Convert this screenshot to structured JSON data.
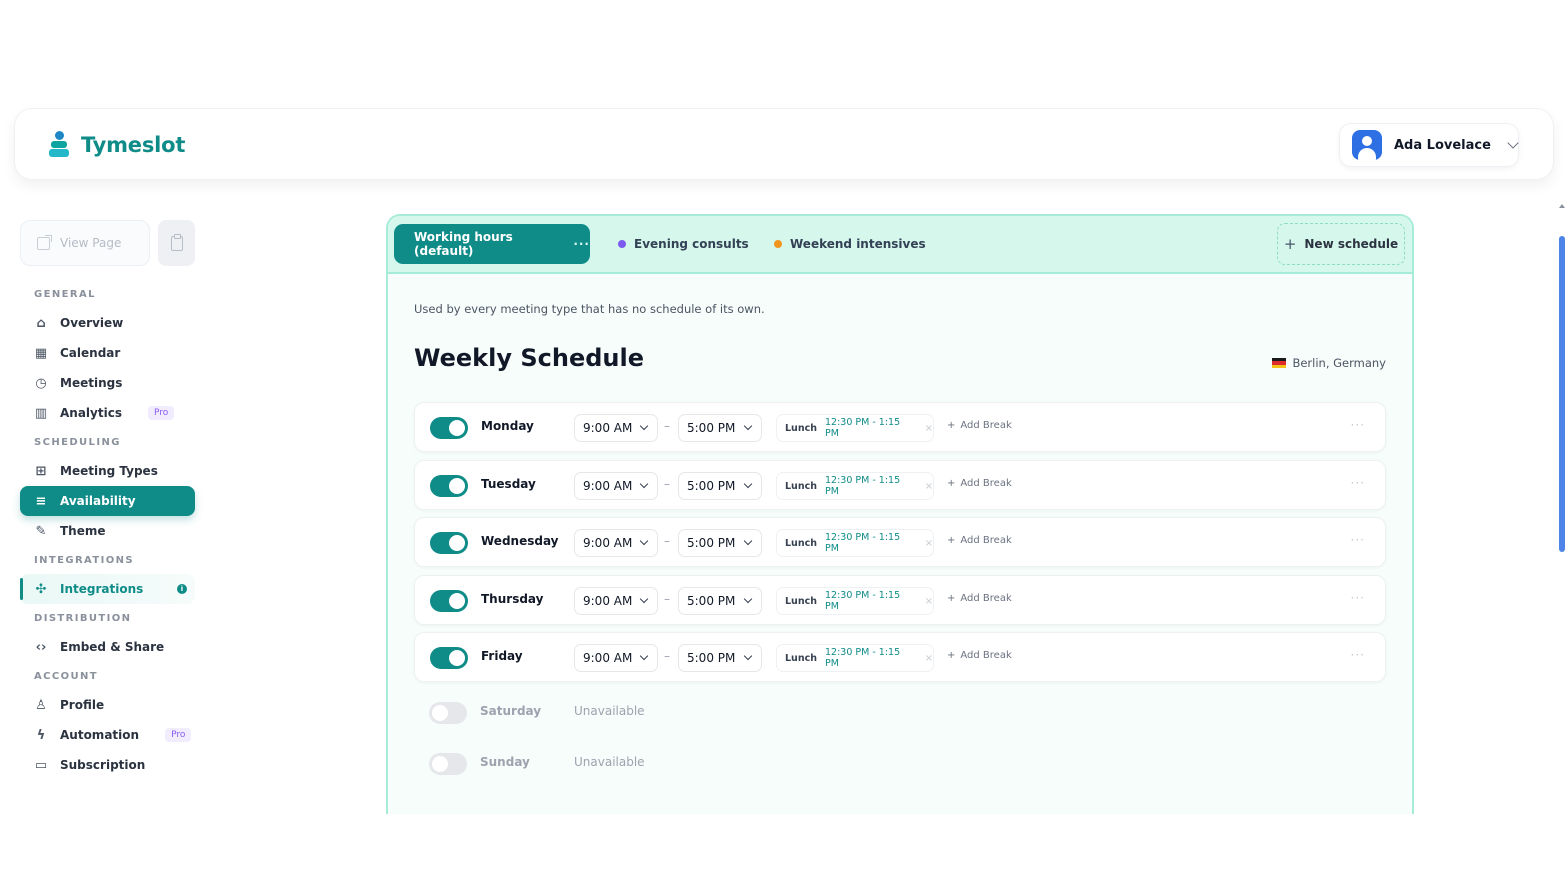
{
  "app": {
    "name": "Tymeslot",
    "user_name": "Ada Lovelace"
  },
  "sidebar": {
    "view_page": "View Page",
    "groups": [
      {
        "label": "GENERAL",
        "items": [
          {
            "label": "Overview",
            "icon": "home-icon"
          },
          {
            "label": "Calendar",
            "icon": "calendar-icon"
          },
          {
            "label": "Meetings",
            "icon": "clock-icon"
          },
          {
            "label": "Analytics",
            "icon": "bar-chart-icon",
            "badge": "Pro"
          }
        ]
      },
      {
        "label": "SCHEDULING",
        "items": [
          {
            "label": "Meeting Types",
            "icon": "grid-icon"
          },
          {
            "label": "Availability",
            "icon": "sliders-icon",
            "active": true
          },
          {
            "label": "Theme",
            "icon": "brush-icon"
          }
        ]
      },
      {
        "label": "INTEGRATIONS",
        "items": [
          {
            "label": "Integrations",
            "icon": "puzzle-icon",
            "highlight": true
          }
        ]
      },
      {
        "label": "DISTRIBUTION",
        "items": [
          {
            "label": "Embed & Share",
            "icon": "code-icon"
          }
        ]
      },
      {
        "label": "ACCOUNT",
        "items": [
          {
            "label": "Profile",
            "icon": "user-icon"
          },
          {
            "label": "Automation",
            "icon": "bolt-icon",
            "badge": "Pro"
          },
          {
            "label": "Subscription",
            "icon": "card-icon"
          }
        ]
      }
    ]
  },
  "tabs": {
    "active": "Working hours (default)",
    "active_more": "···",
    "others": [
      {
        "label": "Evening consults",
        "color": "#7c5cf0"
      },
      {
        "label": "Weekend intensives",
        "color": "#f0961f"
      }
    ],
    "new_schedule": "New schedule"
  },
  "schedule": {
    "description": "Used by every meeting type that has no schedule of its own.",
    "title": "Weekly Schedule",
    "location": "Berlin, Germany",
    "days": [
      {
        "name": "Monday",
        "enabled": true,
        "start": "9:00 AM",
        "end": "5:00 PM",
        "break_label": "Lunch",
        "break_time": "12:30 PM - 1:15 PM"
      },
      {
        "name": "Tuesday",
        "enabled": true,
        "start": "9:00 AM",
        "end": "5:00 PM",
        "break_label": "Lunch",
        "break_time": "12:30 PM - 1:15 PM"
      },
      {
        "name": "Wednesday",
        "enabled": true,
        "start": "9:00 AM",
        "end": "5:00 PM",
        "break_label": "Lunch",
        "break_time": "12:30 PM - 1:15 PM"
      },
      {
        "name": "Thursday",
        "enabled": true,
        "start": "9:00 AM",
        "end": "5:00 PM",
        "break_label": "Lunch",
        "break_time": "12:30 PM - 1:15 PM"
      },
      {
        "name": "Friday",
        "enabled": true,
        "start": "9:00 AM",
        "end": "5:00 PM",
        "break_label": "Lunch",
        "break_time": "12:30 PM - 1:15 PM"
      },
      {
        "name": "Saturday",
        "enabled": false,
        "status": "Unavailable"
      },
      {
        "name": "Sunday",
        "enabled": false,
        "status": "Unavailable"
      }
    ],
    "add_break": "Add Break",
    "separator": "–"
  }
}
